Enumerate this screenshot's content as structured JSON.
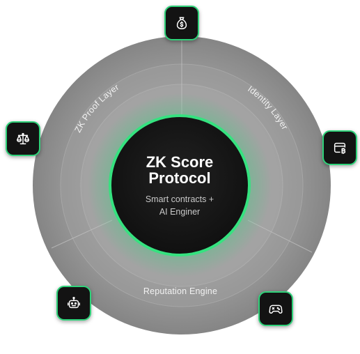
{
  "core": {
    "title_line1": "ZK Score",
    "title_line2": "Protocol",
    "subtitle_line1": "Smart contracts +",
    "subtitle_line2": "AI Enginer"
  },
  "layers": {
    "top_left": "ZK Proof Layer",
    "top_right": "Identity Layer",
    "bottom": "Reputation Engine"
  },
  "nodes": [
    {
      "id": "top",
      "icon": "money-bag-icon"
    },
    {
      "id": "left",
      "icon": "balance-scale-icon"
    },
    {
      "id": "right",
      "icon": "bitcoin-card-icon"
    },
    {
      "id": "bottom-left",
      "icon": "robot-icon"
    },
    {
      "id": "bottom-right",
      "icon": "gamepad-icon"
    }
  ],
  "colors": {
    "accent": "#2fd37a",
    "ring_outer": "#888888",
    "ring_mid": "#9a9a9a",
    "ring_inner": "#a6a6a6",
    "core": "#161616",
    "node_bg": "#131313"
  }
}
